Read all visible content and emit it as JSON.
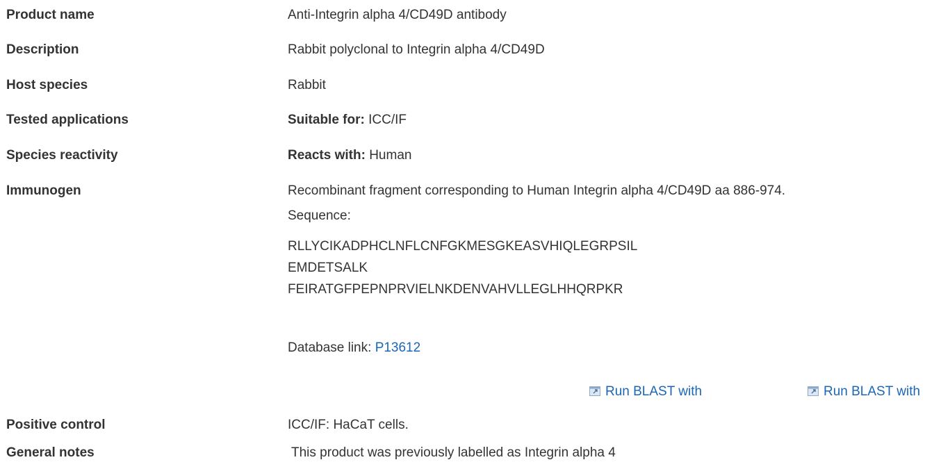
{
  "rows": {
    "product_name": {
      "label": "Product name",
      "value": "Anti-Integrin alpha 4/CD49D antibody"
    },
    "description": {
      "label": "Description",
      "value": "Rabbit polyclonal to Integrin alpha 4/CD49D"
    },
    "host_species": {
      "label": "Host species",
      "value": "Rabbit"
    },
    "tested_applications": {
      "label": "Tested applications",
      "prefix": "Suitable for:",
      "value": "ICC/IF"
    },
    "species_reactivity": {
      "label": "Species reactivity",
      "prefix": "Reacts with:",
      "value": "Human"
    },
    "immunogen": {
      "label": "Immunogen",
      "value": "Recombinant fragment corresponding to Human Integrin alpha 4/CD49D aa 886-974.",
      "sequence_label": "Sequence:",
      "sequence_lines": [
        "RLLYCIKADPHCLNFLCNFGKMESGKEASVHIQLEGRPSIL",
        "EMDETSALK",
        "FEIRATGFPEPNPRVIELNKDENVAHVLLEGLHHQRPKR"
      ],
      "database_link_label": "Database link:",
      "database_link_value": "P13612",
      "blast_links": [
        "Run BLAST with",
        "Run BLAST with"
      ]
    },
    "positive_control": {
      "label": "Positive control",
      "value": "ICC/IF: HaCaT cells."
    },
    "general_notes": {
      "label": "General notes",
      "value": "This product was previously labelled as Integrin alpha 4"
    }
  },
  "icons": {
    "blast": "external-window-icon"
  },
  "colors": {
    "link": "#1a66b8",
    "text": "#333333"
  }
}
